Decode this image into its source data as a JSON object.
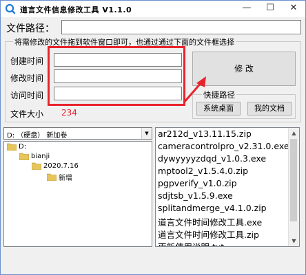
{
  "window": {
    "title": "道言文件信息修改工具 V1.1.0",
    "minimize": "—",
    "maximize": "☐",
    "close": "✕"
  },
  "path_label": "文件路径：",
  "path_value": "",
  "group_title": "将需修改的文件拖到软件窗口即可，也通过通过下面的文件框选择",
  "fields": {
    "created_label": "创建时间",
    "modified_label": "修改时间",
    "accessed_label": "访问时间",
    "created_value": "",
    "modified_value": "",
    "accessed_value": ""
  },
  "size_label": "文件大小",
  "size_value": "234",
  "modify_button": "修 改",
  "shortcuts": {
    "title": "快捷路径",
    "desktop": "系统桌面",
    "documents": "我的文档"
  },
  "drive": {
    "selected": "D: （硬盘） 新加卷",
    "arrow": "▼"
  },
  "tree": [
    "D:",
    "bianji",
    "2020.7.16",
    "新增"
  ],
  "files": [
    "ar212d_v13.11.15.zip",
    "cameracontrolpro_v2.31.0.exe",
    "dywyyyyzdqd_v1.0.3.exe",
    "mptool2_v1.5.4.0.zip",
    "pgpverify_v1.0.zip",
    "sdjtsb_v1.5.9.exe",
    "splitandmerge_v4.1.0.zip",
    "道言文件时间修改工具.exe",
    "道言文件时间修改工具.zip",
    "更新使用说明.txt"
  ],
  "colors": {
    "accent_red": "#e8232b",
    "size_value": "#e8232b",
    "window_border": "#6a8fd0"
  },
  "scroll_up": "▲",
  "scroll_down": "▼"
}
